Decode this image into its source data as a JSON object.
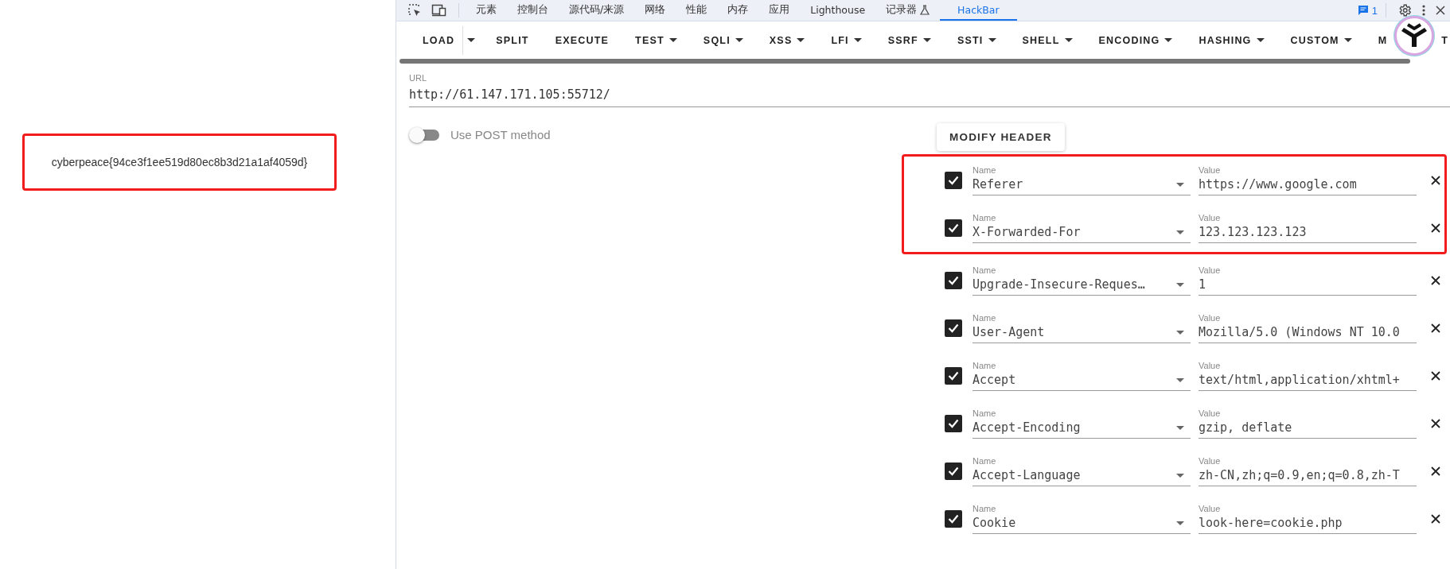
{
  "page": {
    "flag_box": {
      "text": "cyberpeace{94ce3f1ee519d80ec8b3d21a1af4059d}",
      "highlighted": true
    }
  },
  "devtools": {
    "tabs": [
      {
        "label": "元素",
        "selected": false
      },
      {
        "label": "控制台",
        "selected": false
      },
      {
        "label": "源代码/来源",
        "selected": false
      },
      {
        "label": "网络",
        "selected": false
      },
      {
        "label": "性能",
        "selected": false
      },
      {
        "label": "内存",
        "selected": false
      },
      {
        "label": "应用",
        "selected": false
      },
      {
        "label": "Lighthouse",
        "selected": false
      },
      {
        "label": "记录器",
        "selected": false,
        "experimental": true
      },
      {
        "label": "HackBar",
        "selected": true
      }
    ],
    "issues_count": "1"
  },
  "hackbar": {
    "toolbar": [
      {
        "label": "LOAD",
        "kind": "split"
      },
      {
        "label": "SPLIT",
        "kind": "button"
      },
      {
        "label": "EXECUTE",
        "kind": "button"
      },
      {
        "label": "TEST",
        "kind": "menu"
      },
      {
        "label": "SQLI",
        "kind": "menu"
      },
      {
        "label": "XSS",
        "kind": "menu"
      },
      {
        "label": "LFI",
        "kind": "menu"
      },
      {
        "label": "SSRF",
        "kind": "menu"
      },
      {
        "label": "SSTI",
        "kind": "menu"
      },
      {
        "label": "SHELL",
        "kind": "menu"
      },
      {
        "label": "ENCODING",
        "kind": "menu"
      },
      {
        "label": "HASHING",
        "kind": "menu"
      },
      {
        "label": "CUSTOM",
        "kind": "menu"
      },
      {
        "label": "M",
        "kind": "covered"
      },
      {
        "label": "T",
        "kind": "button"
      }
    ],
    "url": {
      "label": "URL",
      "value": "http://61.147.171.105:55712/"
    },
    "post_toggle": {
      "label": "Use POST method",
      "on": false
    },
    "modify_header_button": "MODIFY HEADER",
    "headers": [
      {
        "name_label": "Name",
        "name": "Referer",
        "value_label": "Value",
        "value": "https://www.google.com",
        "checked": true,
        "highlighted": true
      },
      {
        "name_label": "Name",
        "name": "X-Forwarded-For",
        "value_label": "Value",
        "value": "123.123.123.123",
        "checked": true,
        "highlighted": true
      },
      {
        "name_label": "Name",
        "name": "Upgrade-Insecure-Reques…",
        "value_label": "Value",
        "value": "1",
        "checked": true,
        "highlighted": false
      },
      {
        "name_label": "Name",
        "name": "User-Agent",
        "value_label": "Value",
        "value": "Mozilla/5.0 (Windows NT 10.0",
        "checked": true,
        "highlighted": false
      },
      {
        "name_label": "Name",
        "name": "Accept",
        "value_label": "Value",
        "value": "text/html,application/xhtml+",
        "checked": true,
        "highlighted": false
      },
      {
        "name_label": "Name",
        "name": "Accept-Encoding",
        "value_label": "Value",
        "value": "gzip, deflate",
        "checked": true,
        "highlighted": false
      },
      {
        "name_label": "Name",
        "name": "Accept-Language",
        "value_label": "Value",
        "value": "zh-CN,zh;q=0.9,en;q=0.8,zh-T",
        "checked": true,
        "highlighted": false
      },
      {
        "name_label": "Name",
        "name": "Cookie",
        "value_label": "Value",
        "value": "look-here=cookie.php",
        "checked": true,
        "highlighted": false
      }
    ]
  }
}
